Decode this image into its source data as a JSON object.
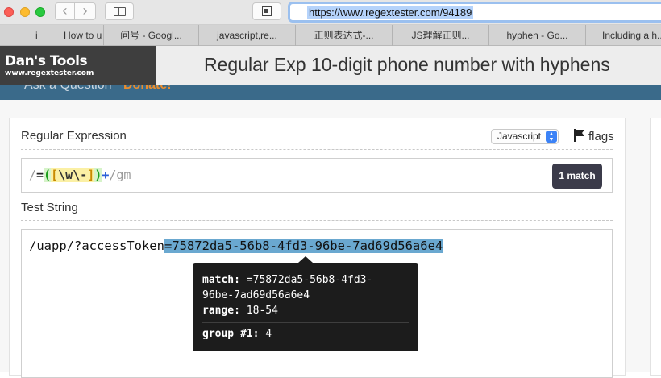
{
  "browser": {
    "url": "https://www.regextester.com/94189",
    "tabs": [
      "i",
      "How to u",
      "问号 - Googl...",
      "javascript,re...",
      "正则表达式-...",
      "JS理解正则...",
      "hyphen - Go...",
      "Including a h..."
    ]
  },
  "site": {
    "logo_title": "Dan's Tools",
    "logo_subtitle": "www.regextester.com",
    "page_heading": "Regular Exp 10-digit phone number with hyphens",
    "nav_links": [
      "Ask a Question",
      "Donate!"
    ]
  },
  "regex_section": {
    "title": "Regular Expression",
    "flavor": "Javascript",
    "flags_label": "flags",
    "delimiter_open": "/",
    "literal": "=",
    "group_open": "(",
    "set_open": "[",
    "escape_w": "\\w",
    "escape_dash": "\\-",
    "set_close": "]",
    "group_close": ")",
    "quantifier": "+",
    "delimiter_close": "/",
    "flags": "gm",
    "match_count": "1 match"
  },
  "test_section": {
    "title": "Test String",
    "prefix": "/uapp/?accessToken",
    "matched": "=75872da5-56b8-4fd3-96be-7ad69d56a6e4"
  },
  "tooltip": {
    "match_label": "match:",
    "match_value_line1": "=75872da5-56b8-4fd3-",
    "match_value_line2": "96be-7ad69d56a6e4",
    "range_label": "range:",
    "range_value": "18-54",
    "group_label": "group #1:",
    "group_value": "4"
  },
  "colors": {
    "header_bar": "#3e3e3e",
    "nav_strip": "#3a6a8a",
    "match_highlight": "#6aa8d0",
    "donate": "#e88c2e"
  }
}
